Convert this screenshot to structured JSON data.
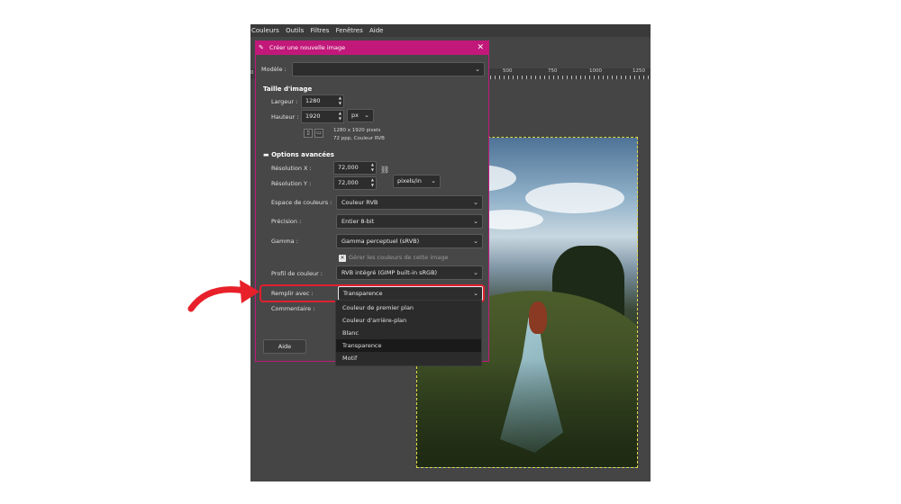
{
  "menubar": {
    "items": [
      "Couleurs",
      "Outils",
      "Filtres",
      "Fenêtres",
      "Aide"
    ]
  },
  "ruler": {
    "labels": [
      "500",
      "750",
      "1000",
      "1250"
    ],
    "left_label": "0"
  },
  "dialog": {
    "title": "Créer une nouvelle image",
    "template": {
      "label": "Modèle :",
      "value": ""
    },
    "size_section": "Taille d'image",
    "width": {
      "label": "Largeur :",
      "value": "1280"
    },
    "height": {
      "label": "Hauteur :",
      "value": "1920"
    },
    "unit": "px",
    "info_line1": "1280 x 1920 pixels",
    "info_line2": "72 ppp, Couleur RVB",
    "advanced_section": "Options avancées",
    "x_resolution": {
      "label": "Résolution X :",
      "value": "72,000"
    },
    "y_resolution": {
      "label": "Résolution Y :",
      "value": "72,000"
    },
    "resolution_unit": "pixels/in",
    "color_space": {
      "label": "Espace de couleurs :",
      "value": "Couleur RVB"
    },
    "precision": {
      "label": "Précision :",
      "value": "Entier 8-bit"
    },
    "gamma": {
      "label": "Gamma :",
      "value": "Gamma perceptuel (sRVB)"
    },
    "manage_colors": "Gérer les couleurs de cette image",
    "color_profile": {
      "label": "Profil de couleur :",
      "value": "RVB intégré (GIMP built-in sRGB)"
    },
    "fill": {
      "label": "Remplir avec :",
      "value": "Transparence"
    },
    "comment": {
      "label": "Commentaire :"
    },
    "help_button": "Aide"
  },
  "fill_dropdown": {
    "options": [
      "Couleur de premier plan",
      "Couleur d'arrière-plan",
      "Blanc",
      "Transparence",
      "Motif"
    ],
    "selected_index": 3
  },
  "colors": {
    "accent": "#c2187a",
    "highlight": "#e02030",
    "arrow": "#e8202a"
  }
}
